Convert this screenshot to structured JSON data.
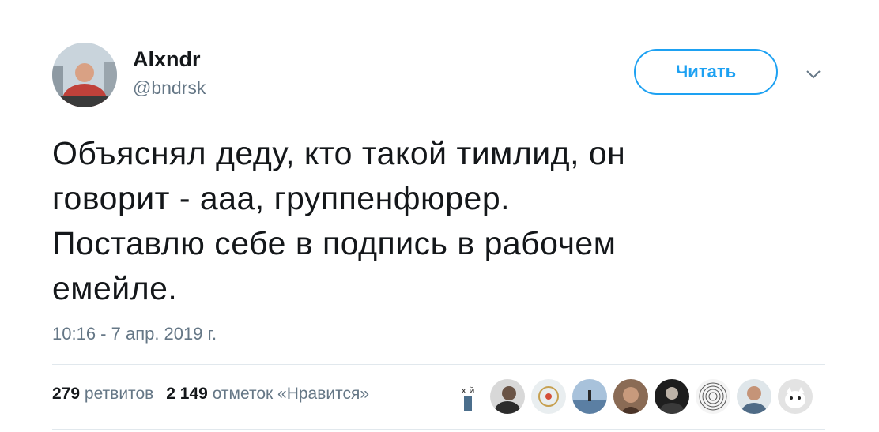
{
  "author": {
    "name": "Alxndr",
    "handle": "@bndrsk"
  },
  "follow_button": {
    "label": "Читать"
  },
  "tweet": {
    "text": "Объяснял деду, кто такой тимлид, он\nговорит - ааа, группенфюрер.\nПоставлю себе в подпись в рабочем\nемейле.",
    "timestamp": "10:16 - 7 апр. 2019 г."
  },
  "stats": {
    "retweets_count": "279",
    "retweets_label": "ретвитов",
    "likes_count": "2 149",
    "likes_label": "отметок «Нравится»"
  },
  "likers_avatar_text": "х й",
  "colors": {
    "accent": "#1da1f2",
    "text": "#14171a",
    "secondary": "#657786",
    "divider": "#e1e8ed"
  }
}
